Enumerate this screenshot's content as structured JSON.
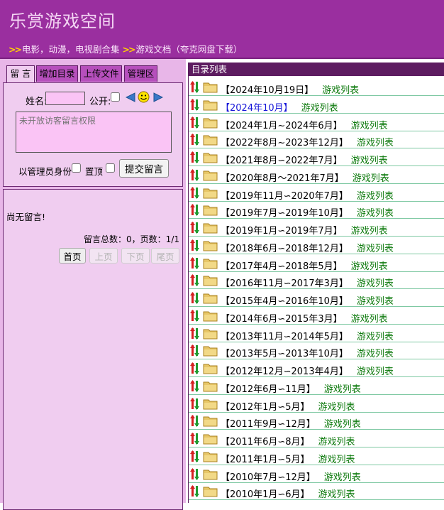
{
  "header": {
    "site_title": "乐赏游戏空间",
    "nav": [
      {
        "arrow": ">>",
        "label": "电影，动漫，电视剧合集"
      },
      {
        "arrow": ">>",
        "label": "游戏文档（夸克网盘下载）"
      }
    ]
  },
  "tabs": [
    "留 言",
    "增加目录",
    "上传文件",
    "管理区"
  ],
  "form": {
    "name_label": "姓名:",
    "name_value": "",
    "public_label": "公开:",
    "message_placeholder": "未开放访客留言权限",
    "admin_label": "以管理员身份",
    "top_label": "置顶",
    "submit_label": "提交留言"
  },
  "messages": {
    "empty_text": "尚无留言!",
    "stats": "留言总数：0，页数：1/1",
    "pager": {
      "first": "首页",
      "prev": "上页",
      "next": "下页",
      "last": "尾页"
    }
  },
  "directory": {
    "header": "目录列表",
    "link_label": "游戏列表",
    "rows": [
      {
        "title": "【2024年10月19日】",
        "highlight": false
      },
      {
        "title": "【2024年10月】",
        "highlight": true
      },
      {
        "title": "【2024年1月~2024年6月】",
        "highlight": false
      },
      {
        "title": "【2022年8月~2023年12月】",
        "highlight": false
      },
      {
        "title": "【2021年8月∽2022年7月】",
        "highlight": false
      },
      {
        "title": "【2020年8月～2021年7月】",
        "highlight": false
      },
      {
        "title": "【2019年11月∽2020年7月】",
        "highlight": false
      },
      {
        "title": "【2019年7月∽2019年10月】",
        "highlight": false
      },
      {
        "title": "【2019年1月∽2019年7月】",
        "highlight": false
      },
      {
        "title": "【2018年6月∽2018年12月】",
        "highlight": false
      },
      {
        "title": "【2017年4月∽2018年5月】",
        "highlight": false
      },
      {
        "title": "【2016年11月∽2017年3月】",
        "highlight": false
      },
      {
        "title": "【2015年4月∽2016年10月】",
        "highlight": false
      },
      {
        "title": "【2014年6月∽2015年3月】",
        "highlight": false
      },
      {
        "title": "【2013年11月∽2014年5月】",
        "highlight": false
      },
      {
        "title": "【2013年5月∽2013年10月】",
        "highlight": false
      },
      {
        "title": "【2012年12月∽2013年4月】",
        "highlight": false
      },
      {
        "title": "【2012年6月∽11月】",
        "highlight": false
      },
      {
        "title": "【2012年1月∽5月】",
        "highlight": false
      },
      {
        "title": "【2011年9月∽12月】",
        "highlight": false
      },
      {
        "title": "【2011年6月∽8月】",
        "highlight": false
      },
      {
        "title": "【2011年1月∽5月】",
        "highlight": false
      },
      {
        "title": "【2010年7月∽12月】",
        "highlight": false
      },
      {
        "title": "【2010年1月∽6月】",
        "highlight": false
      }
    ]
  },
  "icons": {
    "sort_mark": "sort-arrows-icon",
    "folder": "folder-icon",
    "prev": "prev-arrow-icon",
    "smiley": "smiley-icon",
    "next": "next-arrow-icon"
  },
  "colors": {
    "header_bg": "#9a2f9f",
    "panel_bg": "#e8b6e8",
    "link_green": "#0d7a0d",
    "highlight_blue": "#1515d8",
    "row_line": "#7fc9a3"
  }
}
